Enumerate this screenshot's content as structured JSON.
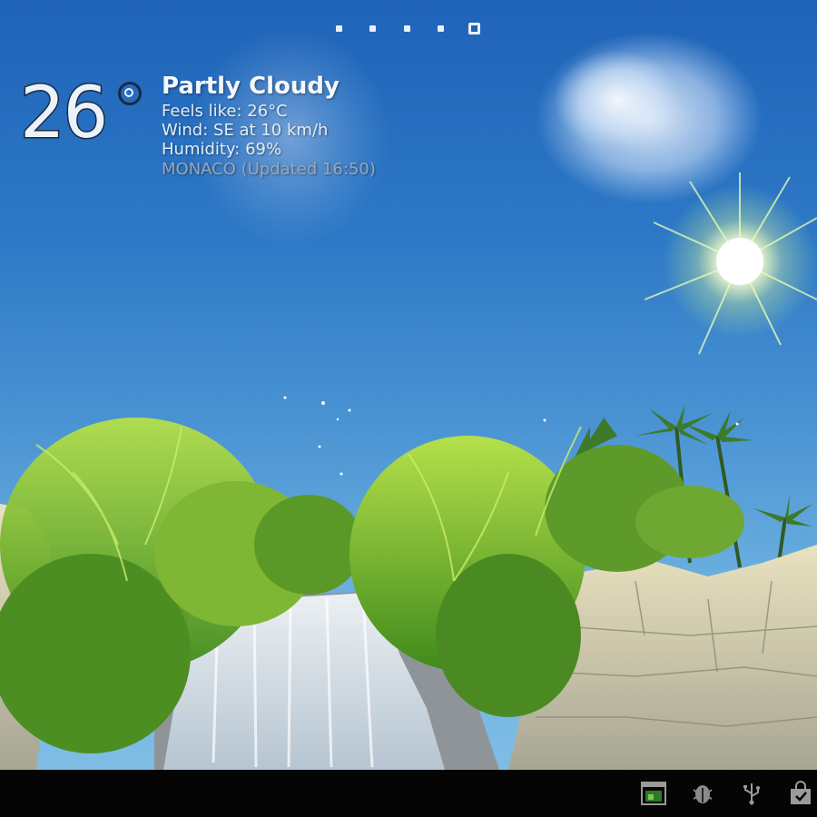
{
  "home_screen": {
    "page_indicator": {
      "count": 5,
      "active_index": 4
    }
  },
  "weather_widget": {
    "temperature": "26",
    "degree_symbol": "°",
    "condition": "Partly Cloudy",
    "feels_like": "Feels like: 26°C",
    "wind": "Wind: SE at 10 km/h",
    "humidity": "Humidity: 69%",
    "location_updated": "MONACO (Updated 16:50)"
  },
  "status_bar": {
    "icons": [
      "screenshot-icon",
      "android-debug-icon",
      "usb-icon",
      "store-bag-icon"
    ]
  },
  "colors": {
    "sky_top": "#1f63b8",
    "sky_bottom": "#7fbde4",
    "nav_background": "#050505"
  }
}
